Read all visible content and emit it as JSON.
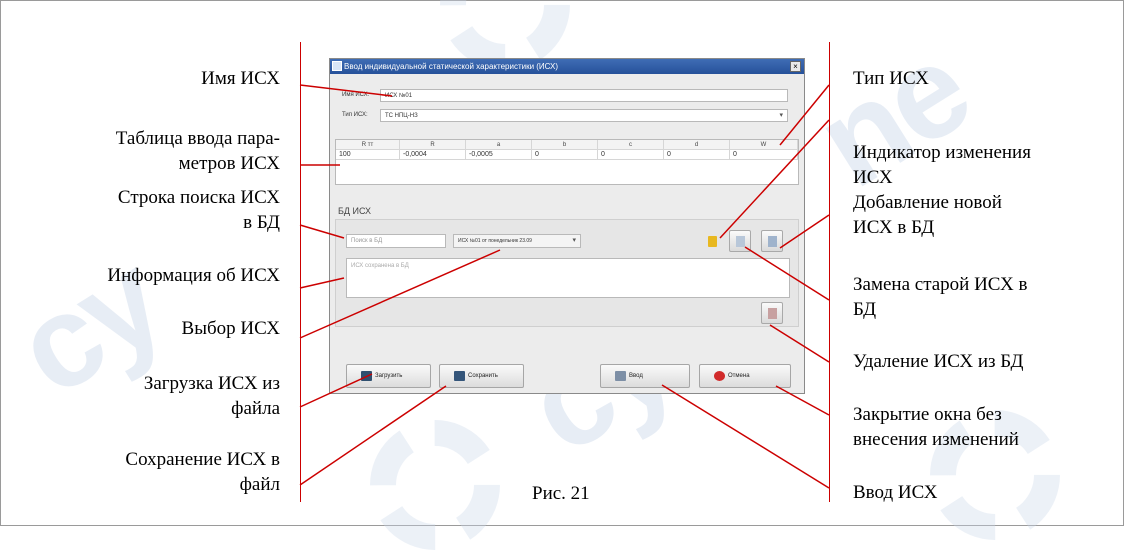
{
  "figure": {
    "caption": "Рис. 21"
  },
  "dialog": {
    "title": "Ввод индивидуальной статической характеристики (ИСХ)",
    "close_label": "×",
    "name_label": "Имя ИСХ:",
    "name_value": "ИСХ №01",
    "type_label": "Тип ИСХ:",
    "type_value": "ТС НПЦ-НЗ",
    "table": {
      "headers": [
        "R тт",
        "R",
        "a",
        "b",
        "c",
        "d",
        "W"
      ],
      "row": [
        "100",
        "-0,0004",
        "-0,0005",
        "0",
        "0",
        "0",
        "0"
      ]
    },
    "db_section_title": "БД ИСХ",
    "search_placeholder": "Поиск в БД",
    "selected_isx": "ИСХ №01 от понедельник 23.09",
    "info_placeholder": "ИСХ сохранена в БД",
    "buttons": {
      "load": "Загрузить",
      "save": "Сохранить",
      "enter": "Ввод",
      "cancel": "Отмена"
    }
  },
  "annotations": {
    "left": [
      "Имя ИСХ",
      "Таблица ввода пара-",
      "метров ИСХ",
      "Строка поиска ИСХ",
      "в БД",
      "Информация об ИСХ",
      "Выбор ИСХ",
      "Загрузка ИСХ из",
      "файла",
      "Сохранение ИСХ в",
      "файл"
    ],
    "right": [
      "Тип ИСХ",
      "Индикатор изменения",
      "ИСХ",
      "Добавление новой",
      "ИСХ в БД",
      "Замена старой ИСХ в",
      "БД",
      "Удаление ИСХ из БД",
      "Закрытие окна без",
      "внесения изменений",
      "Ввод ИСХ"
    ]
  },
  "watermark": "сутерс"
}
